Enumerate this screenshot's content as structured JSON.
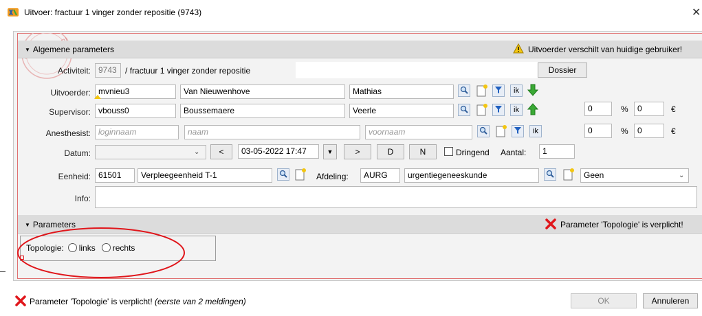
{
  "window": {
    "title": "Uitvoer: fractuur 1 vinger zonder repositie (9743)"
  },
  "general": {
    "header": "Algemene parameters",
    "warning": "Uitvoerder verschilt van huidige gebruiker!",
    "watermark": "development",
    "activity": {
      "label": "Activiteit:",
      "code": "9743",
      "sep": "/",
      "name": "fractuur 1 vinger zonder repositie"
    },
    "dossier_button": "Dossier",
    "executor": {
      "label": "Uitvoerder:",
      "login": "mvnieu3",
      "lastname": "Van Nieuwenhove",
      "firstname": "Mathias"
    },
    "supervisor": {
      "label": "Supervisor:",
      "login": "vbouss0",
      "lastname": "Boussemaere",
      "firstname": "Veerle",
      "percent": "0",
      "euro_value": "0"
    },
    "anesthetist": {
      "label": "Anesthesist:",
      "login_placeholder": "loginnaam",
      "name_placeholder": "naam",
      "firstname_placeholder": "voornaam",
      "percent": "0",
      "euro_value": "0"
    },
    "ik_label": "ik",
    "percent_sign": "%",
    "euro_sign": "€",
    "date": {
      "label": "Datum:",
      "value": "03-05-2022 17:47",
      "prev_button": "<",
      "next_button": ">",
      "d_button": "D",
      "n_button": "N",
      "urgent_label": "Dringend",
      "count_label": "Aantal:",
      "count_value": "1"
    },
    "unit": {
      "label": "Eenheid:",
      "code": "61501",
      "name": "Verpleegeenheid T-1",
      "dept_label": "Afdeling:",
      "dept_code": "AURG",
      "dept_name": "urgentiegeneeskunde",
      "select_value": "Geen"
    },
    "info": {
      "label": "Info:",
      "value": ""
    }
  },
  "parameters": {
    "header": "Parameters",
    "error": "Parameter 'Topologie' is verplicht!",
    "topology_label": "Topologie:",
    "option_left": "links",
    "option_right": "rechts"
  },
  "footer": {
    "message_main": "Parameter 'Topologie' is verplicht!",
    "message_note": "(eerste van 2 meldingen)",
    "ok_button": "OK",
    "cancel_button": "Annuleren"
  },
  "colors": {
    "annotation_red": "#e0161b",
    "accent_blue": "#1f5fbf",
    "green_arrow": "#3aa935",
    "warning_yellow": "#f3c611"
  }
}
